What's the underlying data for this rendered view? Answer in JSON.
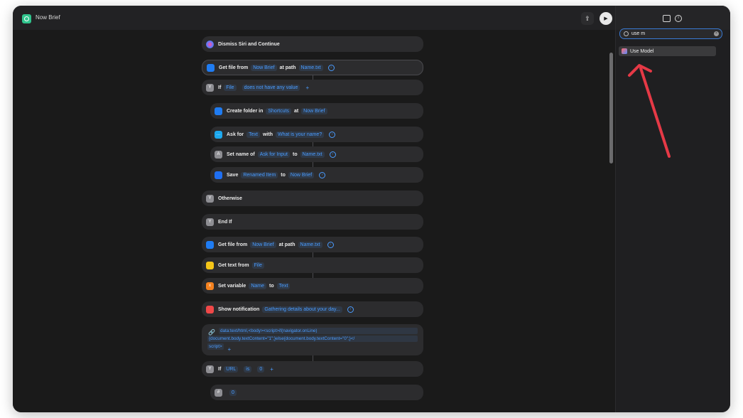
{
  "window": {
    "title": "Now Brief"
  },
  "search": {
    "value": "use m"
  },
  "search_results": [
    {
      "label": "Use Model"
    }
  ],
  "actions": {
    "dismiss": {
      "label": "Dismiss Siri and Continue"
    },
    "getfile1": {
      "label": "Get file from",
      "folder": "Now Brief",
      "mid": "at path",
      "path": "Name.txt"
    },
    "if1": {
      "label": "If",
      "var": "File",
      "cond": "does not have any value"
    },
    "createfolder": {
      "label": "Create folder in",
      "loc": "Shortcuts",
      "mid": "at",
      "name": "Now Brief"
    },
    "ask": {
      "label": "Ask for",
      "type": "Text",
      "mid": "with",
      "prompt": "What is your name?"
    },
    "setname": {
      "label": "Set name of",
      "var": "Ask for Input",
      "mid": "to",
      "name": "Name.txt"
    },
    "save": {
      "label": "Save",
      "var": "Renamed Item",
      "mid": "to",
      "dest": "Now Brief"
    },
    "otherwise": {
      "label": "Otherwise"
    },
    "endif": {
      "label": "End If"
    },
    "getfile2": {
      "label": "Get file from",
      "folder": "Now Brief",
      "mid": "at path",
      "path": "Name.txt"
    },
    "gettext": {
      "label": "Get text from",
      "var": "File"
    },
    "setvar": {
      "label": "Set variable",
      "name": "Name",
      "mid": "to",
      "val": "Text"
    },
    "notif": {
      "label": "Show notification",
      "text": "Gathering details about your day..."
    },
    "url": {
      "line1": "data:text/html,<body><script>if(navigator.onLine)",
      "line2": "{document.body.textContent=\"1\";}else{document.body.textContent=\"0\";}</",
      "line3": "script>"
    },
    "if2": {
      "label": "If",
      "var": "URL",
      "mid": "is",
      "val": "0"
    },
    "num": {
      "val": "0"
    }
  }
}
